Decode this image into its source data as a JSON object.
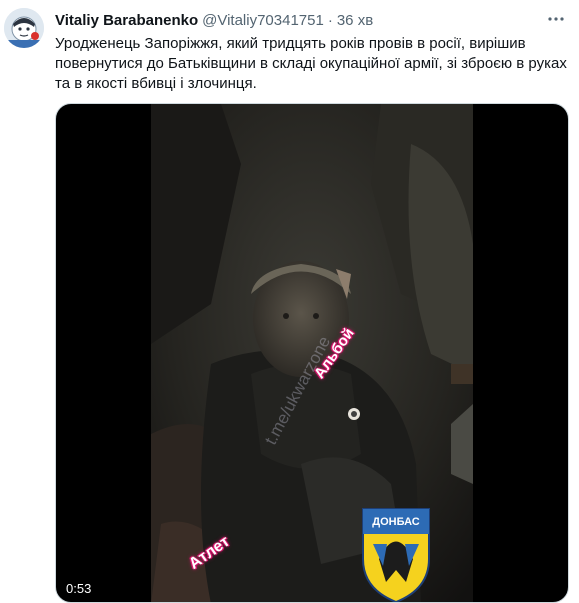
{
  "author": {
    "name": "Vitaliy Barabanenko",
    "handle": "@Vitaliy70341751",
    "separator": "·",
    "time": "36 хв"
  },
  "tweet": {
    "text": "Уродженець Запоріжжя, який тридцять років провів в росії, вирішив повернутися до Батьківщини в складі окупаційної армії, зі зброєю в руках та в якості вбивці і злочинця."
  },
  "video": {
    "duration": "0:53",
    "watermark": "t.me/ukwarzone",
    "sticker_1": "Альбой",
    "sticker_2": "Атлет",
    "emblem_text": "ДОНБАС"
  },
  "icons": {
    "more": "more-horizontal-icon"
  },
  "colors": {
    "text": "#0f1419",
    "secondary": "#536471",
    "sticker_outline": "#d8186e",
    "emblem_yellow": "#f5d21e",
    "emblem_blue": "#2d6bb5"
  }
}
